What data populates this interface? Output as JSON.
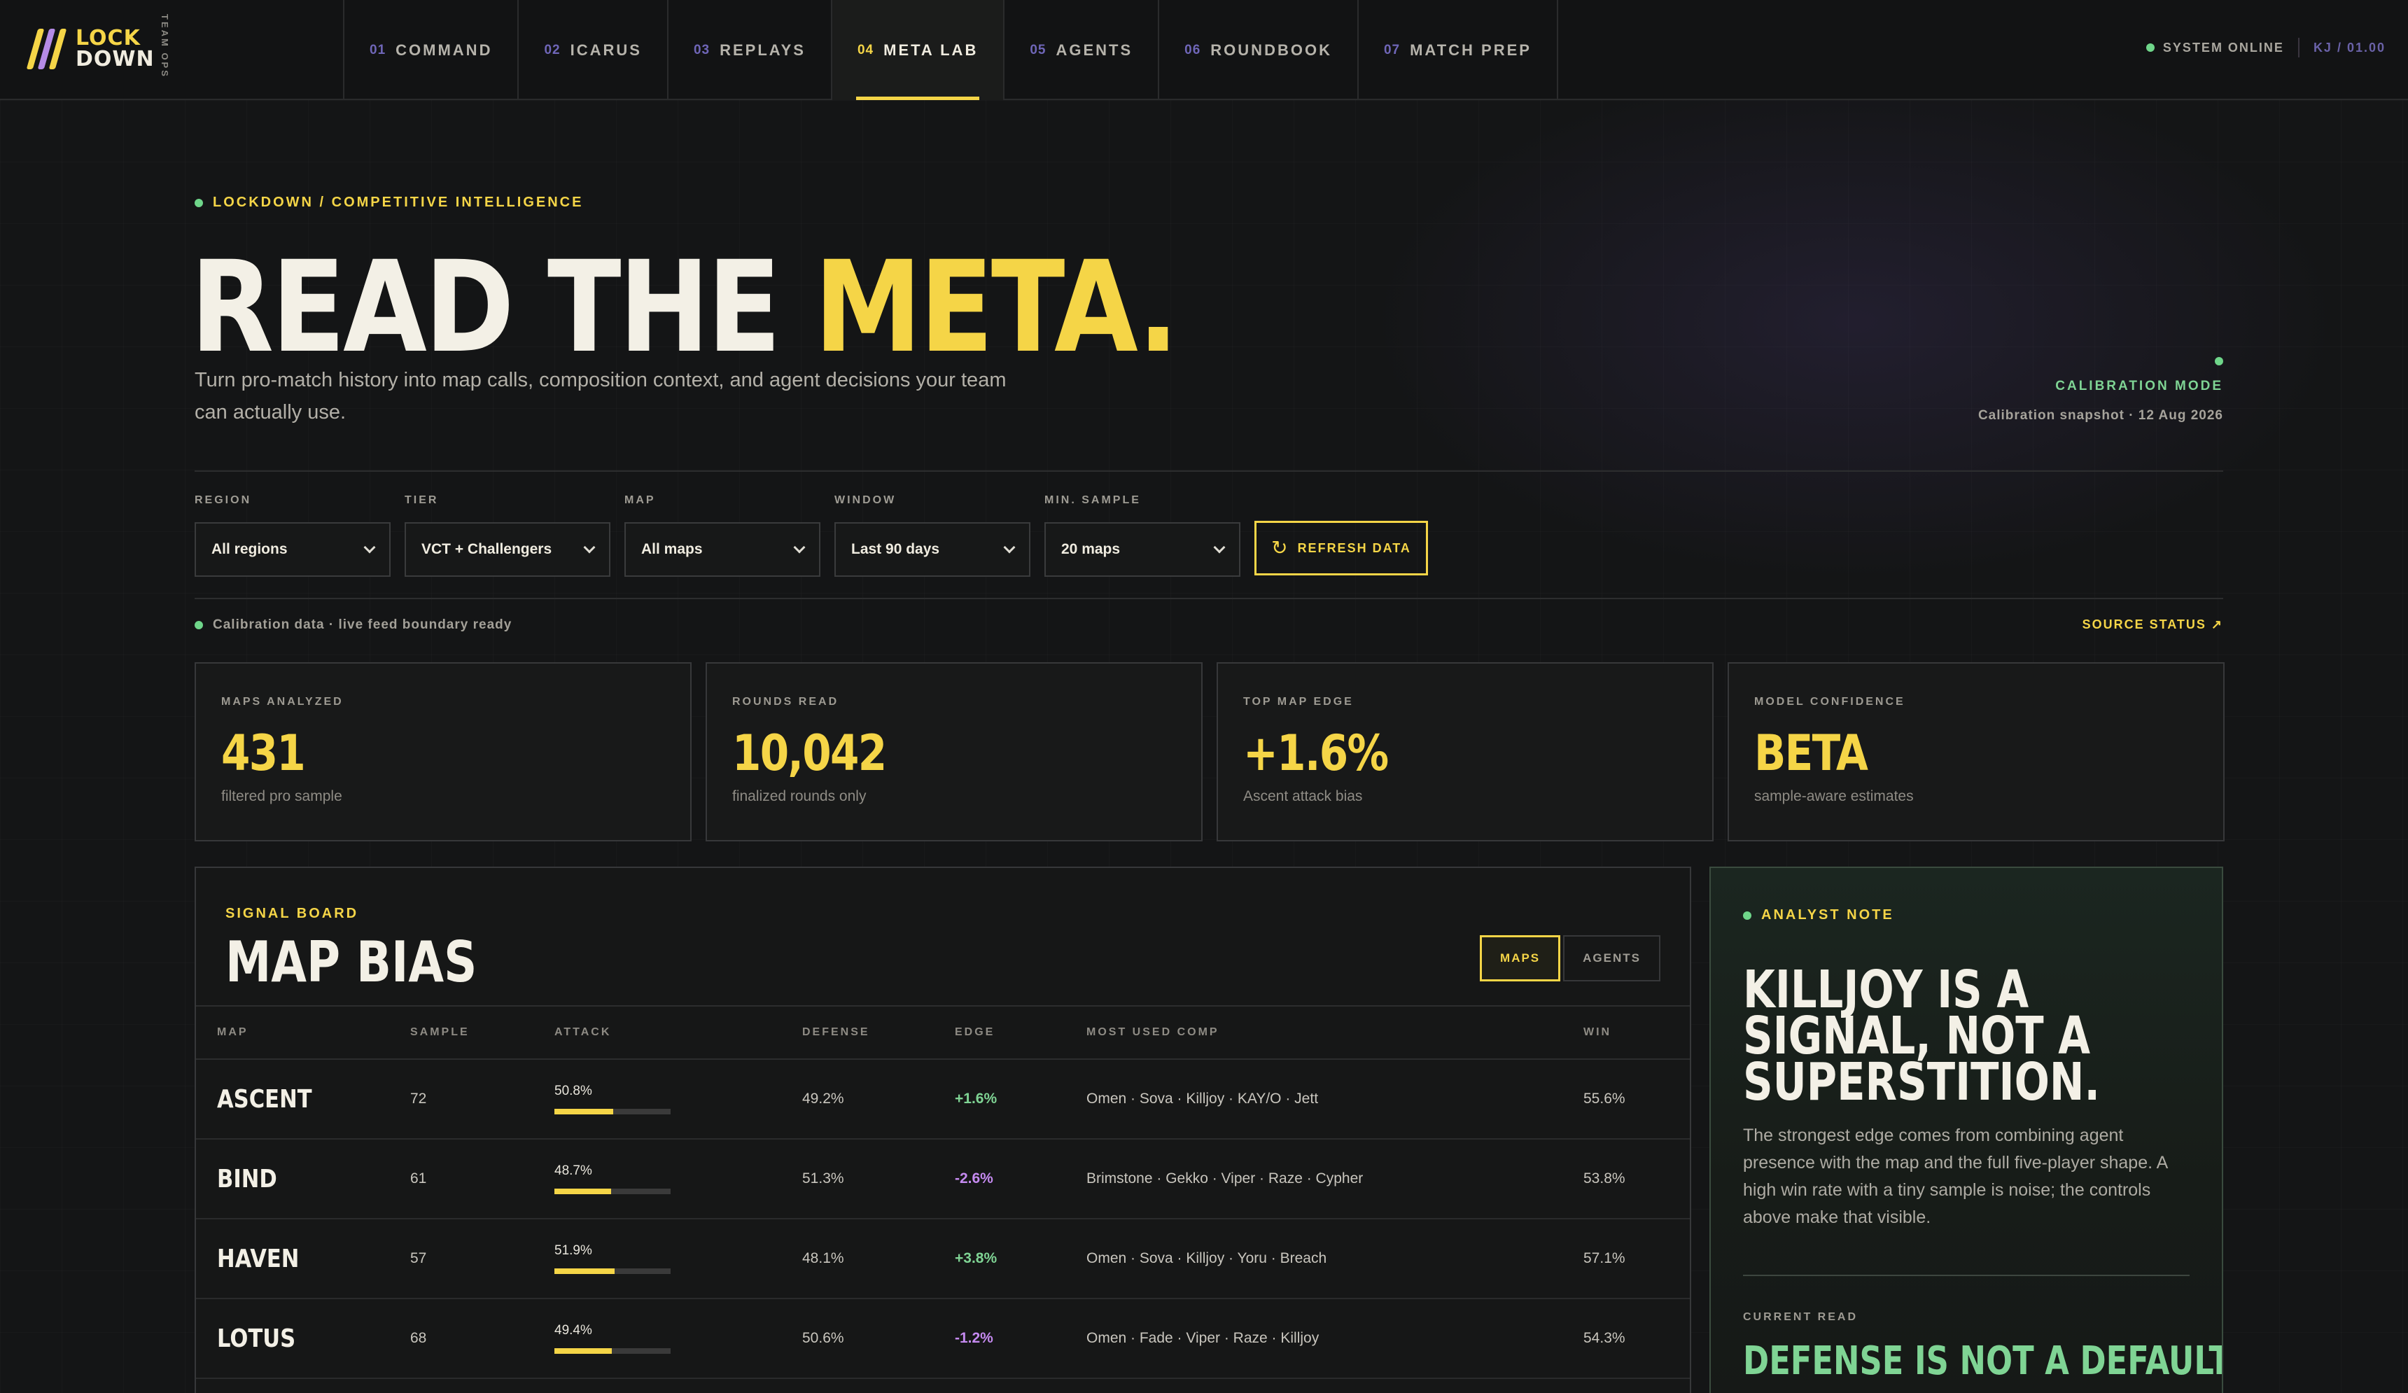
{
  "nav": {
    "logo_line1": "LOCK",
    "logo_line2": "DOWN",
    "logo_sub": "TEAM OPS",
    "tabs": [
      {
        "num": "01",
        "label": "COMMAND"
      },
      {
        "num": "02",
        "label": "ICARUS"
      },
      {
        "num": "03",
        "label": "REPLAYS"
      },
      {
        "num": "04",
        "label": "META LAB"
      },
      {
        "num": "05",
        "label": "AGENTS"
      },
      {
        "num": "06",
        "label": "ROUNDBOOK"
      },
      {
        "num": "07",
        "label": "MATCH PREP"
      }
    ],
    "active_tab": "META LAB",
    "system_status": "SYSTEM ONLINE",
    "user": "KJ / 01.00"
  },
  "hero": {
    "eyebrow": "LOCKDOWN / COMPETITIVE INTELLIGENCE",
    "title_main": "READ THE ",
    "title_accent": "META.",
    "subtitle": "Turn pro-match history into map calls, composition context, and agent decisions your team can actually use.",
    "calibration_mode": "CALIBRATION MODE",
    "calibration_snapshot": "Calibration snapshot · 12 Aug 2026"
  },
  "filters": {
    "region": {
      "label": "REGION",
      "value": "All regions"
    },
    "tier": {
      "label": "TIER",
      "value": "VCT + Challengers"
    },
    "map": {
      "label": "MAP",
      "value": "All maps"
    },
    "window": {
      "label": "WINDOW",
      "value": "Last 90 days"
    },
    "min_sample": {
      "label": "MIN. SAMPLE",
      "value": "20 maps"
    },
    "refresh_label": "REFRESH DATA"
  },
  "status": {
    "line": "Calibration data · live feed boundary ready",
    "source_link": "SOURCE STATUS ↗"
  },
  "stats": [
    {
      "label": "MAPS ANALYZED",
      "value": "431",
      "sub": "filtered pro sample"
    },
    {
      "label": "ROUNDS READ",
      "value": "10,042",
      "sub": "finalized rounds only"
    },
    {
      "label": "TOP MAP EDGE",
      "value": "+1.6%",
      "sub": "Ascent attack bias"
    },
    {
      "label": "MODEL CONFIDENCE",
      "value": "BETA",
      "sub": "sample-aware estimates"
    }
  ],
  "board": {
    "eyebrow": "SIGNAL BOARD",
    "title": "MAP BIAS",
    "toggle_maps": "MAPS",
    "toggle_agents": "AGENTS",
    "columns": [
      "MAP",
      "SAMPLE",
      "ATTACK",
      "DEFENSE",
      "EDGE",
      "MOST USED COMP",
      "WIN"
    ],
    "rows": [
      {
        "map": "ASCENT",
        "sample": "72",
        "attack": "50.8%",
        "attack_pct": 50.8,
        "defense": "49.2%",
        "edge": "+1.6%",
        "edge_dir": "pos",
        "comp": "Omen · Sova · Killjoy · KAY/O · Jett",
        "win": "55.6%"
      },
      {
        "map": "BIND",
        "sample": "61",
        "attack": "48.7%",
        "attack_pct": 48.7,
        "defense": "51.3%",
        "edge": "-2.6%",
        "edge_dir": "neg",
        "comp": "Brimstone · Gekko · Viper · Raze · Cypher",
        "win": "53.8%"
      },
      {
        "map": "HAVEN",
        "sample": "57",
        "attack": "51.9%",
        "attack_pct": 51.9,
        "defense": "48.1%",
        "edge": "+3.8%",
        "edge_dir": "pos",
        "comp": "Omen · Sova · Killjoy · Yoru · Breach",
        "win": "57.1%"
      },
      {
        "map": "LOTUS",
        "sample": "68",
        "attack": "49.4%",
        "attack_pct": 49.4,
        "defense": "50.6%",
        "edge": "-1.2%",
        "edge_dir": "neg",
        "comp": "Omen · Fade · Viper · Raze · Killjoy",
        "win": "54.3%"
      }
    ]
  },
  "note": {
    "eyebrow": "ANALYST NOTE",
    "title": "KILLJOY IS A SIGNAL, NOT A SUPERSTITION.",
    "body": "The strongest edge comes from combining agent presence with the map and the full five-player shape. A high win rate with a tiny sample is noise; the controls above make that visible.",
    "current_read_label": "CURRENT READ",
    "current_read": "DEFENSE IS NOT A DEFAULT."
  },
  "colors": {
    "accent": "#f5d547",
    "positive": "#7fd494",
    "negative": "#c58af0",
    "secondary": "#6f66b8",
    "background": "#141516"
  }
}
